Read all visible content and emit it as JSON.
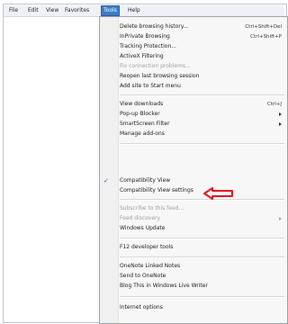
{
  "menubar": {
    "items": [
      "File",
      "Edit",
      "View",
      "Favorites",
      "Tools",
      "Help"
    ]
  },
  "tools_menu": {
    "delete_history": "Delete browsing history...",
    "delete_history_shortcut": "Ctrl+Shift+Del",
    "inprivate": "InPrivate Browsing",
    "inprivate_shortcut": "Ctrl+Shift+P",
    "tracking": "Tracking Protection...",
    "activex": "ActiveX Filtering",
    "fix_connection": "Fix connection problems...",
    "reopen_session": "Reopen last browsing session",
    "add_start_menu": "Add site to Start menu",
    "view_downloads": "View downloads",
    "view_downloads_shortcut": "Ctrl+J",
    "popup_blocker": "Pop-up Blocker",
    "smartscreen": "SmartScreen Filter",
    "manage_addons": "Manage add-ons",
    "compat_view": "Compatibility View",
    "compat_view_settings": "Compatibility View settings",
    "subscribe_feed": "Subscribe to this feed...",
    "feed_discovery": "Feed discovery",
    "windows_update": "Windows Update",
    "f12_tools": "F12 developer tools",
    "onenote_linked": "OneNote Linked Notes",
    "send_onenote": "Send to OneNote",
    "blog_live_writer": "Blog This in Windows Live Writer",
    "internet_options": "Internet options"
  },
  "colors": {
    "highlight_arrow": "#e0141e",
    "active_menu": "#3d7cc9"
  }
}
